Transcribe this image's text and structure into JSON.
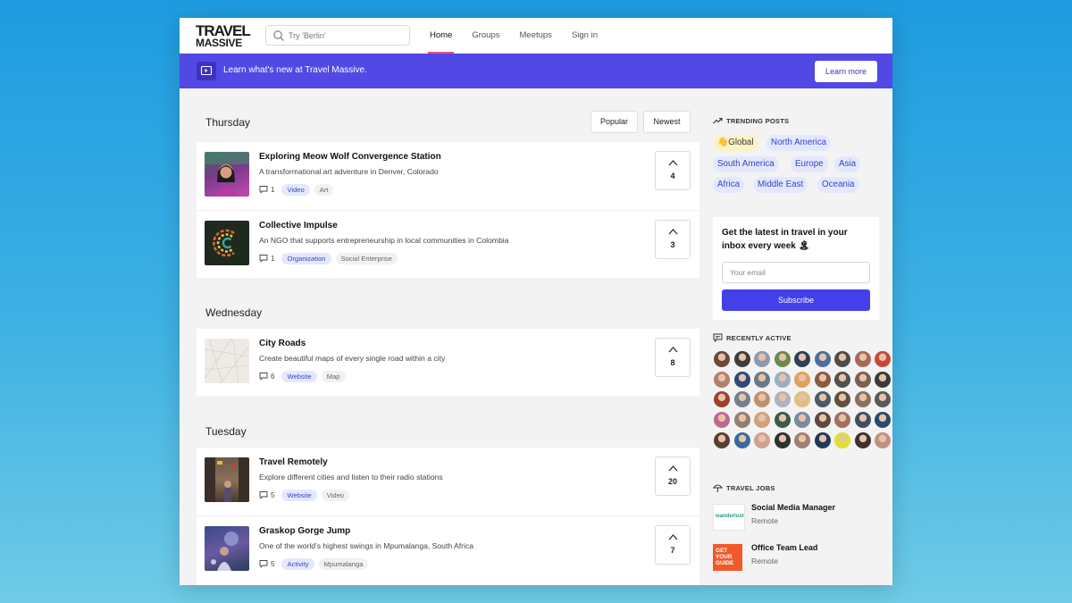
{
  "header": {
    "logo_line1": "TRAVEL",
    "logo_line2": "MASSIVE",
    "search_placeholder": "Try 'Berlin'",
    "nav": [
      {
        "label": "Home",
        "active": true
      },
      {
        "label": "Groups",
        "active": false
      },
      {
        "label": "Meetups",
        "active": false
      },
      {
        "label": "Sign in",
        "active": false
      }
    ]
  },
  "banner": {
    "text": "Learn what's new at Travel Massive.",
    "button": "Learn more"
  },
  "feed": {
    "sort_popular": "Popular",
    "sort_newest": "Newest",
    "days": [
      {
        "label": "Thursday",
        "posts": [
          {
            "title": "Exploring Meow Wolf Convergence Station",
            "description": "A transformational art adventure in Denver, Colorado",
            "comments": "1",
            "tags": [
              "Video",
              "Art"
            ],
            "votes": "4",
            "thumb": "portrait-neon"
          },
          {
            "title": "Collective Impulse",
            "description": "An NGO that supports entrepreneurship in local communities in Colombia",
            "comments": "1",
            "tags": [
              "Organization",
              "Social Enterprise"
            ],
            "votes": "3",
            "thumb": "logo-c"
          }
        ]
      },
      {
        "label": "Wednesday",
        "posts": [
          {
            "title": "City Roads",
            "description": "Create beautiful maps of every single road within a city",
            "comments": "6",
            "tags": [
              "Website",
              "Map"
            ],
            "votes": "8",
            "thumb": "map"
          }
        ]
      },
      {
        "label": "Tuesday",
        "posts": [
          {
            "title": "Travel Remotely",
            "description": "Explore different cities and listen to their radio stations",
            "comments": "5",
            "tags": [
              "Website",
              "Video"
            ],
            "votes": "20",
            "thumb": "street"
          },
          {
            "title": "Graskop Gorge Jump",
            "description": "One of the world's highest swings in Mpumalanga, South Africa",
            "comments": "5",
            "tags": [
              "Activity",
              "Mpumalanga"
            ],
            "votes": "7",
            "thumb": "swing"
          }
        ]
      }
    ]
  },
  "sidebar": {
    "trending_title": "TRENDING POSTS",
    "regions": [
      "👋Global",
      "North America",
      "South America",
      "Europe",
      "Asia",
      "Africa",
      "Middle East",
      "Oceania"
    ],
    "subscribe_title": "Get the latest in travel in your inbox every week 🏝",
    "email_placeholder": "Your email",
    "subscribe_button": "Subscribe",
    "recently_active_title": "RECENTLY ACTIVE",
    "avatar_colors": [
      "#6b4a3a",
      "#3d3d3d",
      "#8d9ab0",
      "#6b8a4a",
      "#2e4058",
      "#4a6fa0",
      "#4d4d4d",
      "#a56a5a",
      "#c64a3a",
      "#c0a0b0",
      "#b08070",
      "#2d4a7a",
      "#6a7a8a",
      "#9ab0c0",
      "#e0a060",
      "#8a5a40",
      "#505050",
      "#7a6050",
      "#3a3a3a",
      "#c03050",
      "#a04030",
      "#708090",
      "#c09070",
      "#b0b0c0",
      "#e0c080",
      "#4a5a6a",
      "#605040",
      "#8a7060",
      "#5a5a5a",
      "#203040",
      "#c06a8a",
      "#908070",
      "#d0a080",
      "#3a5a4a",
      "#7a8aa0",
      "#604a40",
      "#a07060",
      "#405060",
      "#2a4a6a",
      "#8a8a8a",
      "#5a4030",
      "#3a6aa0",
      "#d0a090",
      "#303030",
      "#a08070",
      "#203a5a",
      "#e0e030",
      "#403030",
      "#c09080"
    ],
    "jobs_title": "TRAVEL JOBS",
    "jobs": [
      {
        "title": "Social Media Manager",
        "location": "Remote",
        "logo_text": "wanderlust"
      },
      {
        "title": "Office Team Lead",
        "location": "Remote",
        "logo_text": "GET YOUR GUIDE"
      }
    ]
  }
}
